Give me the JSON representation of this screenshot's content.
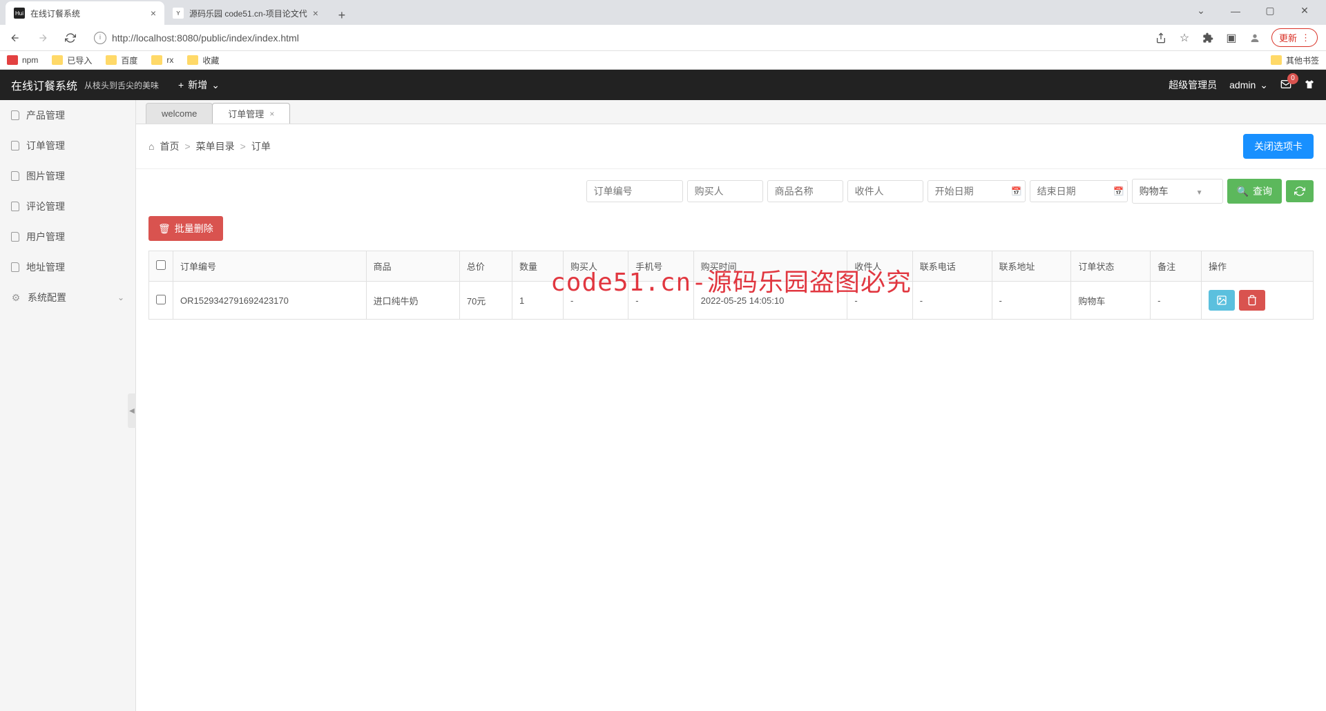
{
  "browser": {
    "tabs": [
      {
        "title": "在线订餐系统",
        "favicon": "Hui"
      },
      {
        "title": "源码乐园 code51.cn-项目论文代",
        "favicon": "Y"
      }
    ],
    "url": "http://localhost:8080/public/index/index.html",
    "update_label": "更新",
    "bookmarks": [
      "npm",
      "已导入",
      "百度",
      "rx",
      "收藏"
    ],
    "other_bookmarks": "其他书签"
  },
  "header": {
    "title": "在线订餐系统",
    "slogan": "从枝头到舌尖的美味",
    "add_label": "新增",
    "role": "超级管理员",
    "username": "admin",
    "mail_count": "0"
  },
  "sidebar": {
    "items": [
      "产品管理",
      "订单管理",
      "图片管理",
      "评论管理",
      "用户管理",
      "地址管理",
      "系统配置"
    ]
  },
  "page_tabs": {
    "welcome": "welcome",
    "order": "订单管理"
  },
  "breadcrumb": {
    "home": "首页",
    "menu": "菜单目录",
    "order": "订单",
    "close_tab": "关闭选项卡"
  },
  "filters": {
    "order_no": "订单编号",
    "buyer": "购买人",
    "product": "商品名称",
    "recipient": "收件人",
    "start_date": "开始日期",
    "end_date": "结束日期",
    "status_selected": "购物车",
    "query": "查询"
  },
  "batch_delete": "批量删除",
  "table": {
    "headers": [
      "订单编号",
      "商品",
      "总价",
      "数量",
      "购买人",
      "手机号",
      "购买时间",
      "收件人",
      "联系电话",
      "联系地址",
      "订单状态",
      "备注",
      "操作"
    ],
    "rows": [
      {
        "order_no": "OR1529342791692423170",
        "product": "进口纯牛奶",
        "total": "70元",
        "qty": "1",
        "buyer": "-",
        "phone": "-",
        "time": "2022-05-25 14:05:10",
        "recipient": "-",
        "contact_phone": "-",
        "contact_addr": "-",
        "status": "购物车",
        "note": "-"
      }
    ]
  },
  "watermark": "code51.cn-源码乐园盗图必究"
}
